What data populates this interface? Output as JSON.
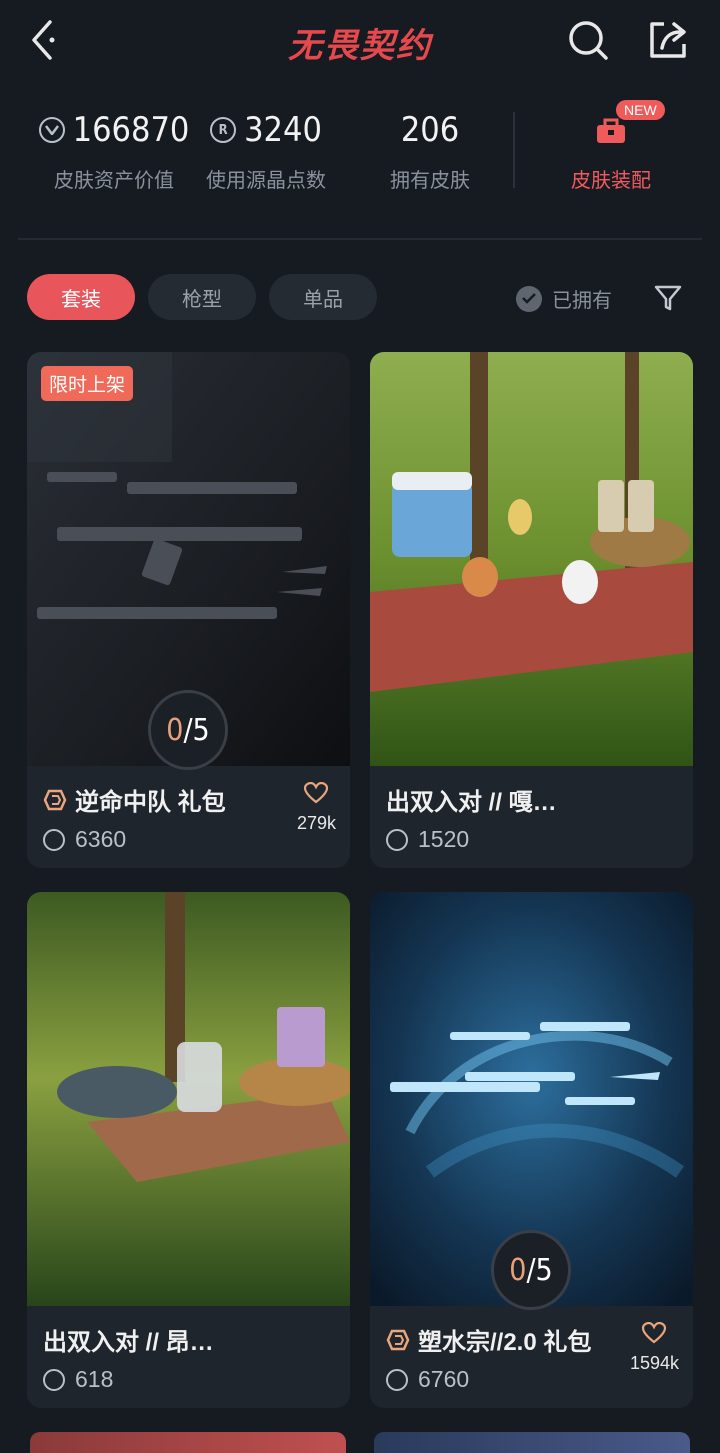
{
  "header": {
    "title": "无畏契约"
  },
  "stats": [
    {
      "value": "166870",
      "label": "皮肤资产价值",
      "icon": "vp-coin-icon"
    },
    {
      "value": "3240",
      "label": "使用源晶点数",
      "icon": "radianite-icon"
    },
    {
      "value": "206",
      "label": "拥有皮肤",
      "icon": ""
    }
  ],
  "equip": {
    "label": "皮肤装配",
    "badge": "NEW"
  },
  "tabs": [
    {
      "label": "套装",
      "active": true
    },
    {
      "label": "枪型",
      "active": false
    },
    {
      "label": "单品",
      "active": false
    }
  ],
  "owned_filter": {
    "label": "已拥有"
  },
  "cards": [
    {
      "title": "逆命中队 礼包",
      "price": "6360",
      "badge": "限时上架",
      "progress_owned": "0",
      "progress_total": "5",
      "favorites": "279k",
      "bundle_icon": true
    },
    {
      "title": "出双入对 // 嘎…",
      "price": "1520"
    },
    {
      "title": "出双入对 // 昂…",
      "price": "618"
    },
    {
      "title": "塑水宗//2.0 礼包",
      "price": "6760",
      "progress_owned": "0",
      "progress_total": "5",
      "favorites": "1594k",
      "bundle_icon": true
    }
  ],
  "colors": {
    "accent": "#e8555a",
    "background": "#161b22",
    "card": "#1f252d"
  }
}
